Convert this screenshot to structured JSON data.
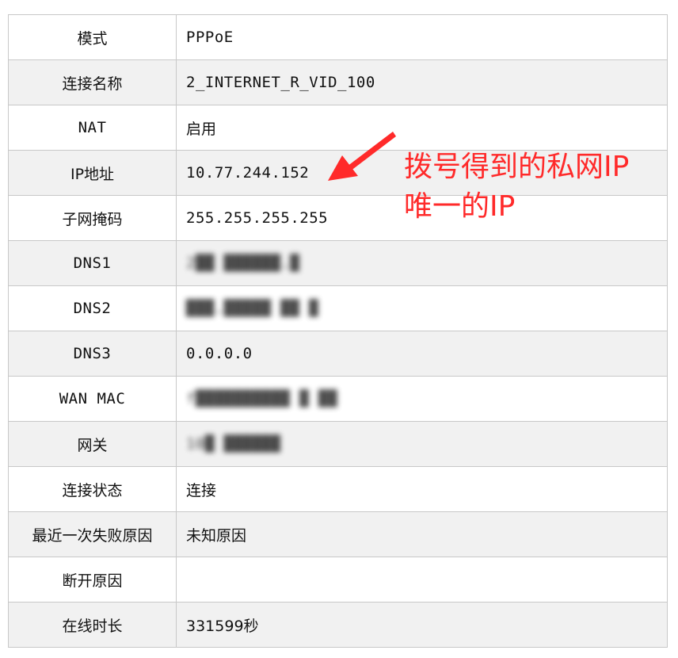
{
  "rows": [
    {
      "label": "模式",
      "value": "PPPoE",
      "mono": true,
      "blur": false
    },
    {
      "label": "连接名称",
      "value": "2_INTERNET_R_VID_100",
      "mono": true,
      "blur": false
    },
    {
      "label": "NAT",
      "value": "启用",
      "mono": false,
      "blur": false
    },
    {
      "label": "IP地址",
      "value": "10.77.244.152",
      "mono": true,
      "blur": false
    },
    {
      "label": "子网掩码",
      "value": "255.255.255.255",
      "mono": true,
      "blur": false
    },
    {
      "label": "DNS1",
      "value": "",
      "mono": true,
      "blur": true
    },
    {
      "label": "DNS2",
      "value": "",
      "mono": true,
      "blur": true
    },
    {
      "label": "DNS3",
      "value": "0.0.0.0",
      "mono": true,
      "blur": false
    },
    {
      "label": "WAN MAC",
      "value": "",
      "mono": true,
      "blur": true
    },
    {
      "label": "网关",
      "value": "",
      "mono": true,
      "blur": true
    },
    {
      "label": "连接状态",
      "value": "连接",
      "mono": false,
      "blur": false
    },
    {
      "label": "最近一次失败原因",
      "value": "未知原因",
      "mono": false,
      "blur": false
    },
    {
      "label": "断开原因",
      "value": "",
      "mono": false,
      "blur": false
    },
    {
      "label": "在线时长",
      "value": "331599秒",
      "mono": false,
      "blur": false
    }
  ],
  "annotation": {
    "line1": "拨号得到的私网IP",
    "line2": "唯一的IP",
    "color": "#ff2a2a"
  },
  "colors": {
    "border": "#c8c8c8",
    "row_alt": "#f1f1f1"
  }
}
